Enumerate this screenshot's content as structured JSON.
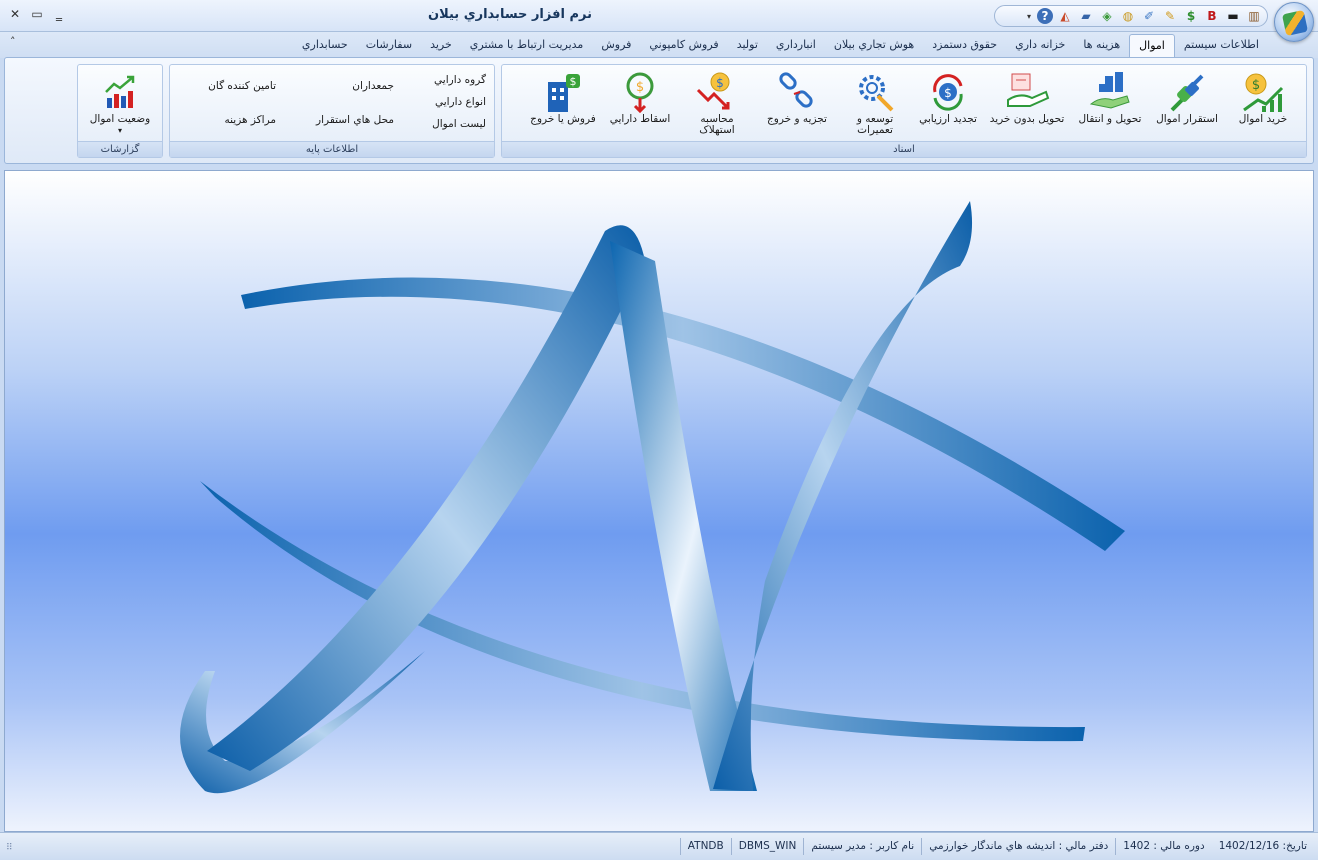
{
  "app": {
    "title": "نرم افزار حسابداري بيلان"
  },
  "window_controls": {
    "close": "✕",
    "restore": "▭",
    "minimize": "‗"
  },
  "quick_access": {
    "items": [
      {
        "icon": "rename-folder-icon",
        "glyph": "▥",
        "color": "#8a5a2b"
      },
      {
        "icon": "printer-icon",
        "glyph": "▬",
        "color": "#1d1d1d"
      },
      {
        "icon": "bold-b-icon",
        "glyph": "B",
        "color": "#c0191b"
      },
      {
        "icon": "dollar-icon",
        "glyph": "$",
        "color": "#2f8f2f"
      },
      {
        "icon": "palette-icon",
        "glyph": "✎",
        "color": "#d19a1c"
      },
      {
        "icon": "pencil-card-icon",
        "glyph": "✐",
        "color": "#3e79c5"
      },
      {
        "icon": "coins-icon",
        "glyph": "◍",
        "color": "#c9981d"
      },
      {
        "icon": "money-hand-icon",
        "glyph": "◈",
        "color": "#3c9a3c"
      },
      {
        "icon": "book-icon",
        "glyph": "▰",
        "color": "#3564a8"
      },
      {
        "icon": "hat-icon",
        "glyph": "◭",
        "color": "#c94a2a"
      },
      {
        "icon": "help-icon",
        "glyph": "?",
        "color": "#2c5ea8"
      }
    ],
    "dropdown": "▾"
  },
  "ribbon_tabs": {
    "collapse": "˄",
    "items": [
      {
        "label": "حسابداري",
        "active": false
      },
      {
        "label": "سفارشات",
        "active": false
      },
      {
        "label": "خريد",
        "active": false
      },
      {
        "label": "مديريت ارتباط با مشتري",
        "active": false
      },
      {
        "label": "فروش",
        "active": false
      },
      {
        "label": "فروش کامپوني",
        "active": false
      },
      {
        "label": "توليد",
        "active": false
      },
      {
        "label": "انبارداري",
        "active": false
      },
      {
        "label": "هوش تجاري بيلان",
        "active": false
      },
      {
        "label": "حقوق دستمزد",
        "active": false
      },
      {
        "label": "خزانه داري",
        "active": false
      },
      {
        "label": "هزينه ها",
        "active": false
      },
      {
        "label": "اموال",
        "active": true
      },
      {
        "label": "اطلاعات سيستم",
        "active": false
      }
    ]
  },
  "groups": {
    "asnad": {
      "label": "اسناد",
      "buttons": [
        {
          "label": "خريد اموال",
          "icon": "purchase-assets-icon"
        },
        {
          "label": "استقرار اموال",
          "icon": "plug-icon"
        },
        {
          "label": "تحويل و انتقال",
          "icon": "transfer-icon"
        },
        {
          "label": "تحويل بدون خريد",
          "icon": "delivery-icon"
        },
        {
          "label": "تجديد ارزيابي",
          "icon": "revaluation-icon"
        },
        {
          "label": "توسعه و\nتعميرات",
          "icon": "repair-gear-icon"
        },
        {
          "label": "تجزيه و خروج",
          "icon": "broken-link-icon"
        },
        {
          "label": "محاسبه\nاستهلاک",
          "icon": "depreciation-icon"
        },
        {
          "label": "اسقاط دارايي",
          "icon": "scrap-icon"
        },
        {
          "label": "فروش يا خروج",
          "icon": "sell-building-icon"
        }
      ]
    },
    "base_info": {
      "label": "اطلاعات پايه",
      "col1": [
        "گروه دارايي",
        "انواع دارايي",
        "ليست اموال"
      ],
      "col2": [
        "جمعداران",
        "محل هاي استقرار"
      ],
      "col3": [
        "تامين کننده گان",
        "مراکز هزينه"
      ]
    },
    "reports": {
      "label": "گزارشات",
      "button": {
        "label": "وضعيت اموال",
        "icon": "bar-chart-icon",
        "dropdown": "▾"
      }
    }
  },
  "status_bar": {
    "grip": "⠿",
    "items": [
      "ATNDB",
      "DBMS_WIN",
      "نام کاربر : مدير سيستم",
      "دفتر مالي : انديشه هاي ماندگار خوارزمي",
      "دوره مالي : 1402",
      "تاريخ: 1402/12/16"
    ]
  },
  "colors": {
    "accent": "#1f5fa8",
    "logo_dark": "#0b5fa8",
    "logo_light": "#e8f1fb"
  }
}
